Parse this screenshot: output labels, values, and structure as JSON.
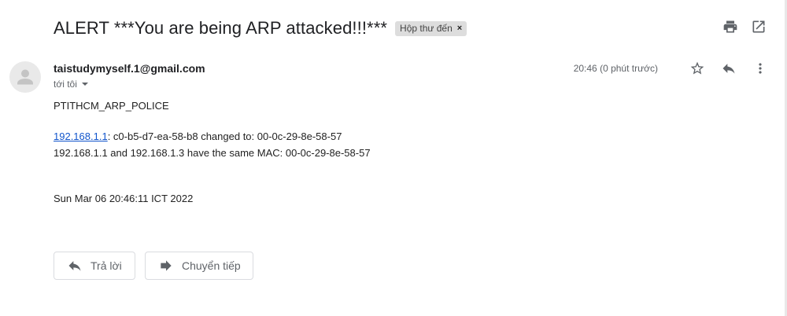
{
  "email": {
    "subject": "ALERT ***You are being ARP attacked!!!***",
    "label": "Hộp thư đến",
    "label_remove": "×",
    "sender": "taistudymyself.1@gmail.com",
    "recipient": "tới tôi",
    "timestamp": "20:46 (0 phút trước)",
    "body": {
      "line1": "PTITHCM_ARP_POLICE",
      "link_ip": "192.168.1.1",
      "line2_rest": ": c0-b5-d7-ea-58-b8 changed to: 00-0c-29-8e-58-57",
      "line3": "192.168.1.1 and 192.168.1.3 have the same MAC: 00-0c-29-8e-58-57",
      "line4": "Sun Mar 06 20:46:11 ICT 2022"
    }
  },
  "actions": {
    "reply_label": "Trả lời",
    "forward_label": "Chuyển tiếp"
  },
  "icons": {
    "print": "print-icon",
    "open_new_window": "open-in-new-window-icon",
    "star": "star-icon",
    "reply": "reply-icon",
    "more": "more-vert-icon",
    "avatar": "avatar-icon",
    "forward": "forward-icon"
  }
}
